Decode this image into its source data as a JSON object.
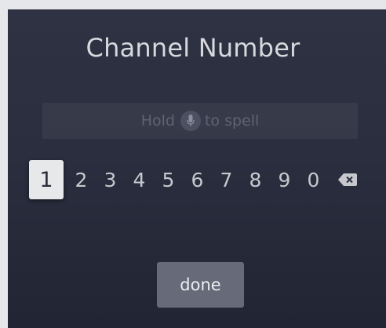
{
  "dialog": {
    "title": "Channel Number"
  },
  "entry": {
    "hint_before": "Hold",
    "hint_after": "to spell",
    "mic_icon": "microphone-icon"
  },
  "keypad": {
    "keys": [
      "1",
      "2",
      "3",
      "4",
      "5",
      "6",
      "7",
      "8",
      "9",
      "0"
    ],
    "focused_key": "1",
    "delete_icon": "backspace-icon"
  },
  "actions": {
    "done_label": "done"
  },
  "colors": {
    "background": "#2a2e3e",
    "focused_key_bg": "#e7e8ea",
    "done_button_bg": "#676a78"
  }
}
